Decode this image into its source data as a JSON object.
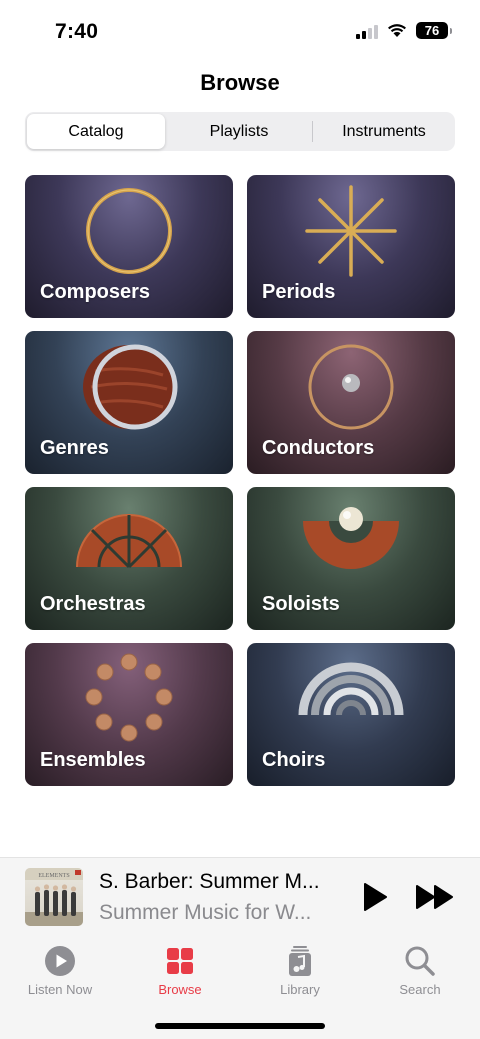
{
  "status": {
    "time": "7:40",
    "battery": "76"
  },
  "header": {
    "title": "Browse"
  },
  "segments": [
    "Catalog",
    "Playlists",
    "Instruments"
  ],
  "selected_segment": "Catalog",
  "tiles": [
    {
      "label": "Composers"
    },
    {
      "label": "Periods"
    },
    {
      "label": "Genres"
    },
    {
      "label": "Conductors"
    },
    {
      "label": "Orchestras"
    },
    {
      "label": "Soloists"
    },
    {
      "label": "Ensembles"
    },
    {
      "label": "Choirs"
    }
  ],
  "now_playing": {
    "title": "S. Barber: Summer M...",
    "subtitle": "Summer Music for W...",
    "album_art_text": "ELEMENTS"
  },
  "tabs": [
    {
      "label": "Listen Now",
      "icon": "play-circle-icon"
    },
    {
      "label": "Browse",
      "icon": "grid-icon"
    },
    {
      "label": "Library",
      "icon": "music-library-icon"
    },
    {
      "label": "Search",
      "icon": "search-icon"
    }
  ],
  "active_tab": "Browse",
  "colors": {
    "accent": "#e83c47",
    "gold": "#d4a24c",
    "tab_inactive": "#8e8e93"
  }
}
